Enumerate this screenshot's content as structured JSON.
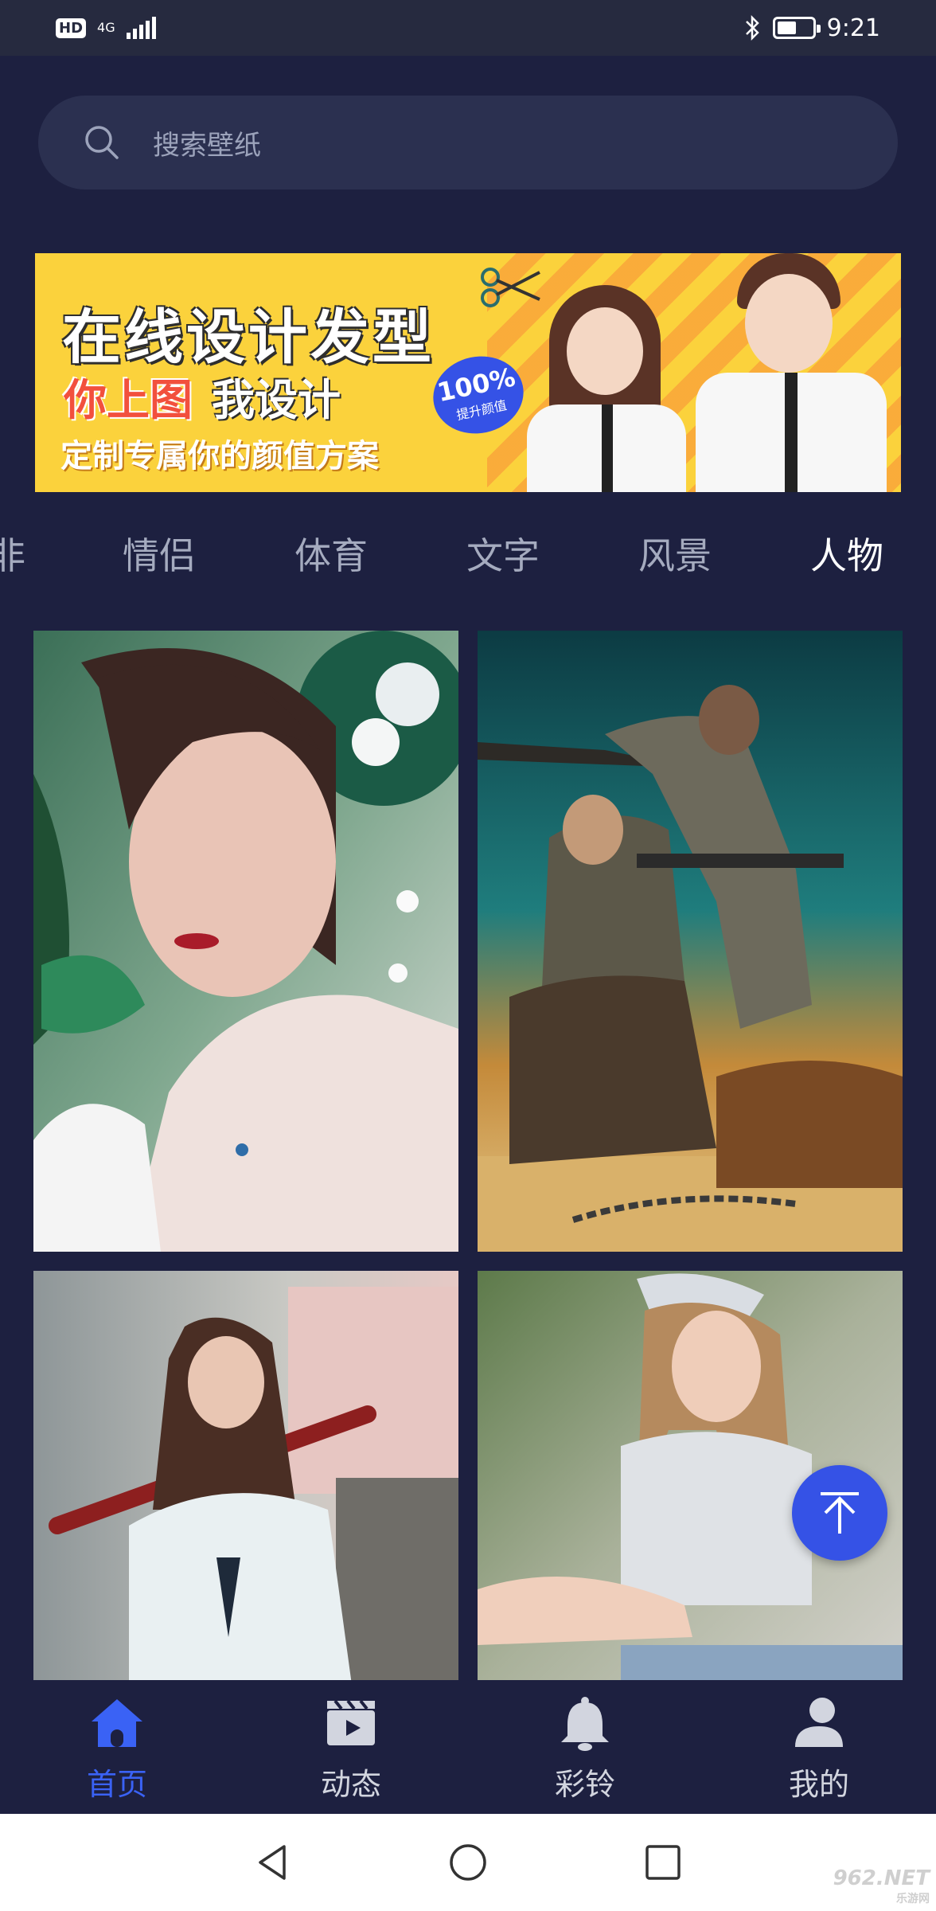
{
  "status_bar": {
    "hd": "HD",
    "network": "4G",
    "time": "9:21"
  },
  "search": {
    "placeholder": "搜索壁纸"
  },
  "banner": {
    "title": "在线设计发型",
    "line2_a": "你上图",
    "line2_b": "我设计",
    "line3": "定制专属你的颜值方案",
    "badge_big": "100%",
    "badge_small": "提升颜值"
  },
  "categories": {
    "cut_off": "非",
    "items": [
      "情侣",
      "体育",
      "文字",
      "风景",
      "人物"
    ],
    "active": "人物"
  },
  "wallpapers": [
    {
      "icon": "woman-with-flowers-photo"
    },
    {
      "icon": "wasteland-warriors-photo"
    },
    {
      "icon": "girl-with-baseball-bat-photo"
    },
    {
      "icon": "woman-in-cap-photo"
    }
  ],
  "bottom_nav": {
    "items": [
      {
        "label": "首页",
        "icon": "home-icon",
        "active": true
      },
      {
        "label": "动态",
        "icon": "clapperboard-icon",
        "active": false
      },
      {
        "label": "彩铃",
        "icon": "bell-icon",
        "active": false
      },
      {
        "label": "我的",
        "icon": "user-icon",
        "active": false
      }
    ]
  },
  "colors": {
    "background": "#1d2040",
    "accent": "#3552e6",
    "banner_yellow": "#fbd23c"
  },
  "watermark": {
    "text": "962.NET",
    "sub": "乐游网"
  }
}
